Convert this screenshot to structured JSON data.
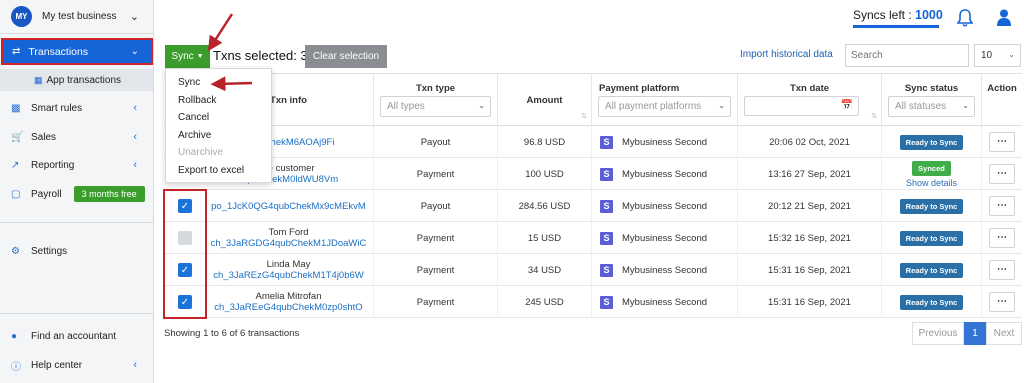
{
  "sidebar": {
    "avatar": "MY",
    "business_name": "My test business",
    "active_item": "Transactions",
    "sub_item": "App transactions",
    "items": [
      {
        "label": "Smart rules",
        "icon": "rules-icon"
      },
      {
        "label": "Sales",
        "icon": "cart-icon"
      },
      {
        "label": "Reporting",
        "icon": "chart-icon"
      },
      {
        "label": "Payroll",
        "icon": "dollar-icon",
        "badge": "3 months free"
      },
      {
        "label": "Settings",
        "icon": "gear-icon"
      },
      {
        "label": "Find an accountant",
        "icon": "person-icon"
      },
      {
        "label": "Help center",
        "icon": "help-icon"
      }
    ]
  },
  "header": {
    "syncs_left_label": "Syncs left :",
    "syncs_left_value": "1000"
  },
  "toolbar": {
    "sync_label": "Sync",
    "selected_text": "Txns selected: 3",
    "clear_label": "Clear selection",
    "import_label": "Import historical data",
    "search_placeholder": "Search",
    "page_size": "10"
  },
  "dropdown": {
    "items": [
      "Sync",
      "Rollback",
      "Cancel",
      "Archive",
      "Unarchive",
      "Export to excel"
    ]
  },
  "table": {
    "columns": {
      "txn_info": "Txn info",
      "txn_type": "Txn type",
      "txn_type_filter": "All types",
      "amount": "Amount",
      "payment_platform": "Payment platform",
      "platform_filter": "All payment platforms",
      "txn_date": "Txn date",
      "sync_status": "Sync status",
      "status_filter": "All statuses",
      "action": "Action"
    },
    "rows": [
      {
        "name": "",
        "id": "4qubChekM6AOAj9Fi",
        "type": "Payout",
        "amount": "96.8 USD",
        "platform": "Mybusiness Second",
        "date": "20:06 02 Oct, 2021",
        "status": "Ready to Sync",
        "checkbox": "hidden"
      },
      {
        "name": "pe customer",
        "id": "4qubChekM0ldWU8Vm",
        "type": "Payment",
        "amount": "100 USD",
        "platform": "Mybusiness Second",
        "date": "13:16 27 Sep, 2021",
        "status": "Synced",
        "details": "Show details",
        "checkbox": "hidden"
      },
      {
        "name": "",
        "id": "po_1JcK0QG4qubChekMx9cMEkvM",
        "type": "Payout",
        "amount": "284.56 USD",
        "platform": "Mybusiness Second",
        "date": "20:12 21 Sep, 2021",
        "status": "Ready to Sync",
        "checkbox": "on"
      },
      {
        "name": "Tom Ford",
        "id": "ch_3JaRGDG4qubChekM1JDoaWiC",
        "type": "Payment",
        "amount": "15 USD",
        "platform": "Mybusiness Second",
        "date": "15:32 16 Sep, 2021",
        "status": "Ready to Sync",
        "checkbox": "off"
      },
      {
        "name": "Linda May",
        "id": "ch_3JaREzG4qubChekM1T4j0b6W",
        "type": "Payment",
        "amount": "34 USD",
        "platform": "Mybusiness Second",
        "date": "15:31 16 Sep, 2021",
        "status": "Ready to Sync",
        "checkbox": "on"
      },
      {
        "name": "Amelia Mitrofan",
        "id": "ch_3JaREeG4qubChekM0zp0shtO",
        "type": "Payment",
        "amount": "245 USD",
        "platform": "Mybusiness Second",
        "date": "15:31 16 Sep, 2021",
        "status": "Ready to Sync",
        "checkbox": "on"
      }
    ]
  },
  "footer": {
    "showing": "Showing 1 to 6 of 6 transactions",
    "previous": "Previous",
    "page": "1",
    "next": "Next"
  },
  "colors": {
    "primary": "#1565d8",
    "sync_green": "#3b9d2c",
    "annotation_red": "#c4242b"
  }
}
